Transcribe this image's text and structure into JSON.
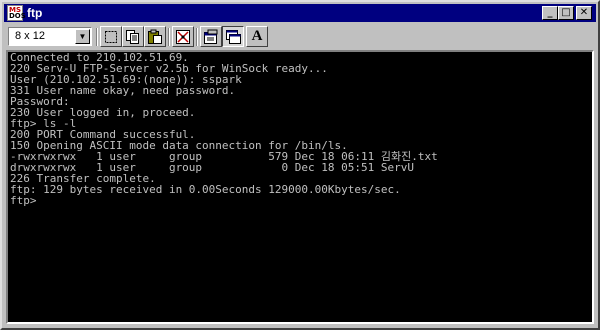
{
  "window": {
    "title": "ftp",
    "icon_text_top": "MS",
    "icon_text_bottom": "DOS",
    "minimize_glyph": "_",
    "maximize_glyph": "□",
    "close_glyph": "✕"
  },
  "toolbar": {
    "font_size_value": "8 x 12",
    "dropdown_glyph": "▼",
    "font_tool_label": "A",
    "tools": [
      "mark-icon",
      "copy-icon",
      "paste-icon",
      "fullscreen-icon",
      "properties-icon",
      "background-icon",
      "font-icon"
    ]
  },
  "console": {
    "lines": [
      "Connected to 210.102.51.69.",
      "220 Serv-U FTP-Server v2.5b for WinSock ready...",
      "User (210.102.51.69:(none)): sspark",
      "331 User name okay, need password.",
      "Password:",
      "230 User logged in, proceed.",
      "ftp> ls -l",
      "200 PORT Command successful.",
      "150 Opening ASCII mode data connection for /bin/ls.",
      "-rwxrwxrwx   1 user     group          579 Dec 18 06:11 김화진.txt",
      "drwxrwxrwx   1 user     group            0 Dec 18 05:51 ServU",
      "226 Transfer complete.",
      "ftp: 129 bytes received in 0.00Seconds 129000.00Kbytes/sec.",
      "ftp>"
    ]
  }
}
